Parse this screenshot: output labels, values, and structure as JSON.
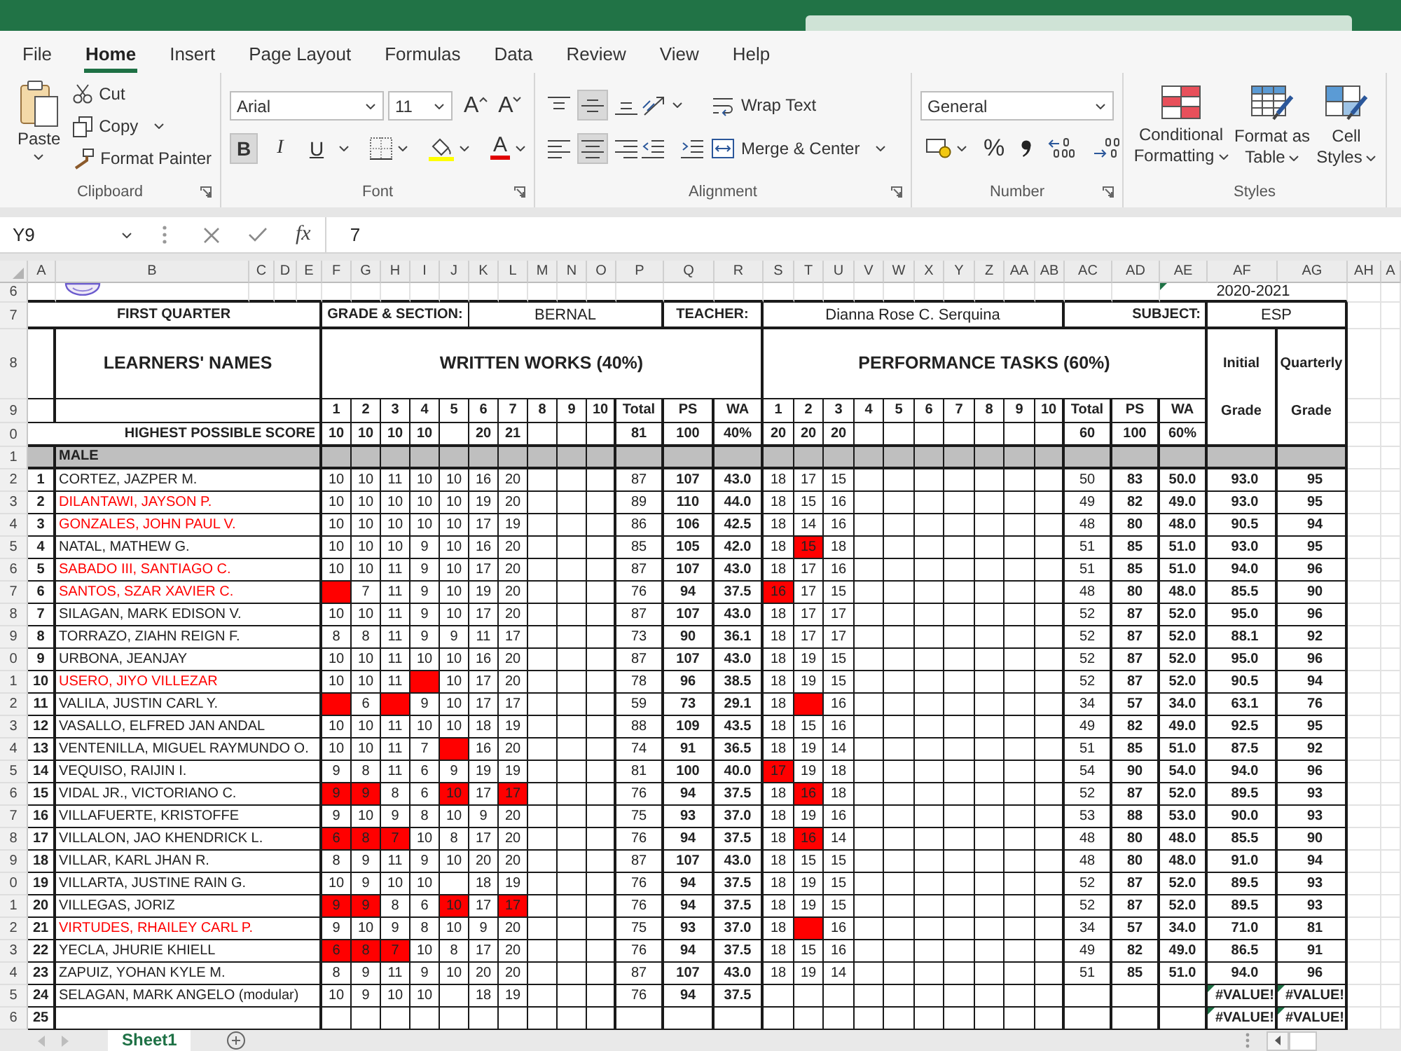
{
  "menu_tabs": [
    {
      "label": "File",
      "selected": false
    },
    {
      "label": "Home",
      "selected": true
    },
    {
      "label": "Insert",
      "selected": false
    },
    {
      "label": "Page Layout",
      "selected": false
    },
    {
      "label": "Formulas",
      "selected": false
    },
    {
      "label": "Data",
      "selected": false
    },
    {
      "label": "Review",
      "selected": false
    },
    {
      "label": "View",
      "selected": false
    },
    {
      "label": "Help",
      "selected": false
    }
  ],
  "ribbon": {
    "clipboard": {
      "paste": "Paste",
      "cut": "Cut",
      "copy": "Copy",
      "format_painter": "Format Painter",
      "label": "Clipboard"
    },
    "font": {
      "name": "Arial",
      "size": "11",
      "grow": "A",
      "shrink": "A",
      "styles": [
        {
          "label": "B",
          "kind": "bold",
          "selected": true
        },
        {
          "label": "I",
          "kind": "italic",
          "selected": false
        },
        {
          "label": "U",
          "kind": "underline",
          "selected": false
        }
      ],
      "font_color": "A",
      "label": "Font"
    },
    "alignment": {
      "vertical": [
        {
          "kind": "top",
          "selected": false
        },
        {
          "kind": "middle",
          "selected": true
        },
        {
          "kind": "bottom",
          "selected": false
        }
      ],
      "horizontal": [
        {
          "kind": "left",
          "selected": false
        },
        {
          "kind": "center",
          "selected": true
        },
        {
          "kind": "right",
          "selected": false
        }
      ],
      "wrap_text": "Wrap Text",
      "merge": "Merge & Center",
      "label": "Alignment"
    },
    "number": {
      "format": "General",
      "percent": "%",
      "label": "Number"
    },
    "styles": {
      "buttons": [
        {
          "label": "Conditional Formatting",
          "kind": "conditional"
        },
        {
          "label": "Format as Table",
          "kind": "table"
        },
        {
          "label": "Cell Styles",
          "kind": "cell"
        }
      ],
      "label": "Styles"
    }
  },
  "formula_bar": {
    "name_box": "Y9",
    "function_label": "fx",
    "formula": "7"
  },
  "sheet": {
    "column_headers": [
      "A",
      "B",
      "C",
      "D",
      "E",
      "F",
      "G",
      "H",
      "I",
      "J",
      "K",
      "L",
      "M",
      "N",
      "O",
      "P",
      "Q",
      "R",
      "S",
      "T",
      "U",
      "V",
      "W",
      "X",
      "Y",
      "Z",
      "AA",
      "AB",
      "AC",
      "AD",
      "AE",
      "AF",
      "AG",
      "AH",
      "A"
    ],
    "header_row_numbers": [
      "6",
      "7",
      "8",
      "9",
      "0",
      "1"
    ],
    "school_year": "2020-2021",
    "school_year_error_mark": true,
    "quarter": "FIRST QUARTER",
    "grade_section_label": "GRADE & SECTION:",
    "grade_section": "BERNAL",
    "teacher_label": "TEACHER:",
    "teacher": "Dianna Rose C. Serquina",
    "subject_label": "SUBJECT:",
    "subject": "ESP",
    "names_heading": "LEARNERS' NAMES",
    "written_heading": "WRITTEN WORKS (40%)",
    "performance_heading": "PERFORMANCE TASKS (60%)",
    "initial_heading": "Initial",
    "initial_subheading": "Grade",
    "quarterly_heading": "Quarterly",
    "quarterly_subheading": "Grade",
    "written_columns": [
      "1",
      "2",
      "3",
      "4",
      "5",
      "6",
      "7",
      "8",
      "9",
      "10",
      "Total",
      "PS",
      "WA"
    ],
    "performance_columns": [
      "1",
      "2",
      "3",
      "4",
      "5",
      "6",
      "7",
      "8",
      "9",
      "10",
      "Total",
      "PS",
      "WA"
    ],
    "highest_possible": {
      "label": "HIGHEST POSSIBLE SCORE",
      "written_scores": [
        {
          "kind": "score",
          "score": "10"
        },
        {
          "kind": "score",
          "score": "10"
        },
        {
          "kind": "score",
          "score": "10"
        },
        {
          "kind": "score",
          "score": "10"
        },
        {
          "kind": "blank"
        },
        {
          "kind": "score",
          "score": "20"
        },
        {
          "kind": "score",
          "score": "21"
        }
      ],
      "written_total": "81",
      "written_ps": "100",
      "written_wa": "40%",
      "performance_scores": [
        {
          "kind": "score",
          "score": "20"
        },
        {
          "kind": "score",
          "score": "20"
        },
        {
          "kind": "score",
          "score": "20"
        }
      ],
      "performance_total": "60",
      "performance_ps": "100",
      "performance_wa": "60%"
    },
    "group_label": "MALE",
    "learners": [
      {
        "number": "1",
        "row_number": "2",
        "name": "CORTEZ, JAZPER M.",
        "color": "#222222",
        "written_scores": [
          {
            "score": "10",
            "highlighted": false
          },
          {
            "score": "10",
            "highlighted": false
          },
          {
            "score": "11",
            "highlighted": false
          },
          {
            "score": "10",
            "highlighted": false
          },
          {
            "score": "10",
            "highlighted": false
          },
          {
            "score": "16",
            "highlighted": false
          },
          {
            "score": "20",
            "highlighted": false
          }
        ],
        "written_total": "87",
        "written_ps": "107",
        "written_wa": "43.0",
        "performance_scores": [
          {
            "score": "18",
            "highlighted": false
          },
          {
            "score": "17",
            "highlighted": false
          },
          {
            "score": "15",
            "highlighted": false
          }
        ],
        "performance_total": "50",
        "performance_ps": "83",
        "performance_wa": "50.0",
        "initial_grade": "93.0",
        "quarterly_grade": "95",
        "grade_error_marks": false
      },
      {
        "number": "2",
        "row_number": "3",
        "name": "DILANTAWI, JAYSON P.",
        "color": "#ff0000",
        "written_scores": [
          {
            "score": "10",
            "highlighted": false
          },
          {
            "score": "10",
            "highlighted": false
          },
          {
            "score": "10",
            "highlighted": false
          },
          {
            "score": "10",
            "highlighted": false
          },
          {
            "score": "10",
            "highlighted": false
          },
          {
            "score": "19",
            "highlighted": false
          },
          {
            "score": "20",
            "highlighted": false
          }
        ],
        "written_total": "89",
        "written_ps": "110",
        "written_wa": "44.0",
        "performance_scores": [
          {
            "score": "18",
            "highlighted": false
          },
          {
            "score": "15",
            "highlighted": false
          },
          {
            "score": "16",
            "highlighted": false
          }
        ],
        "performance_total": "49",
        "performance_ps": "82",
        "performance_wa": "49.0",
        "initial_grade": "93.0",
        "quarterly_grade": "95",
        "grade_error_marks": false
      },
      {
        "number": "3",
        "row_number": "4",
        "name": "GONZALES, JOHN PAUL V.",
        "color": "#ff0000",
        "written_scores": [
          {
            "score": "10",
            "highlighted": false
          },
          {
            "score": "10",
            "highlighted": false
          },
          {
            "score": "10",
            "highlighted": false
          },
          {
            "score": "10",
            "highlighted": false
          },
          {
            "score": "10",
            "highlighted": false
          },
          {
            "score": "17",
            "highlighted": false
          },
          {
            "score": "19",
            "highlighted": false
          }
        ],
        "written_total": "86",
        "written_ps": "106",
        "written_wa": "42.5",
        "performance_scores": [
          {
            "score": "18",
            "highlighted": false
          },
          {
            "score": "14",
            "highlighted": false
          },
          {
            "score": "16",
            "highlighted": false
          }
        ],
        "performance_total": "48",
        "performance_ps": "80",
        "performance_wa": "48.0",
        "initial_grade": "90.5",
        "quarterly_grade": "94",
        "grade_error_marks": false
      },
      {
        "number": "4",
        "row_number": "5",
        "name": "NATAL, MATHEW G.",
        "color": "#222222",
        "written_scores": [
          {
            "score": "10",
            "highlighted": false
          },
          {
            "score": "10",
            "highlighted": false
          },
          {
            "score": "10",
            "highlighted": false
          },
          {
            "score": "9",
            "highlighted": false
          },
          {
            "score": "10",
            "highlighted": false
          },
          {
            "score": "16",
            "highlighted": false
          },
          {
            "score": "20",
            "highlighted": false
          }
        ],
        "written_total": "85",
        "written_ps": "105",
        "written_wa": "42.0",
        "performance_scores": [
          {
            "score": "18",
            "highlighted": false
          },
          {
            "score": "15",
            "highlighted": true
          },
          {
            "score": "18",
            "highlighted": false
          }
        ],
        "performance_total": "51",
        "performance_ps": "85",
        "performance_wa": "51.0",
        "initial_grade": "93.0",
        "quarterly_grade": "95",
        "grade_error_marks": false
      },
      {
        "number": "5",
        "row_number": "6",
        "name": "SABADO III, SANTIAGO C.",
        "color": "#ff0000",
        "written_scores": [
          {
            "score": "10",
            "highlighted": false
          },
          {
            "score": "10",
            "highlighted": false
          },
          {
            "score": "11",
            "highlighted": false
          },
          {
            "score": "9",
            "highlighted": false
          },
          {
            "score": "10",
            "highlighted": false
          },
          {
            "score": "17",
            "highlighted": false
          },
          {
            "score": "20",
            "highlighted": false
          }
        ],
        "written_total": "87",
        "written_ps": "107",
        "written_wa": "43.0",
        "performance_scores": [
          {
            "score": "18",
            "highlighted": false
          },
          {
            "score": "17",
            "highlighted": false
          },
          {
            "score": "16",
            "highlighted": false
          }
        ],
        "performance_total": "51",
        "performance_ps": "85",
        "performance_wa": "51.0",
        "initial_grade": "94.0",
        "quarterly_grade": "96",
        "grade_error_marks": false
      },
      {
        "number": "6",
        "row_number": "7",
        "name": "SANTOS, SZAR XAVIER C.",
        "color": "#ff0000",
        "written_scores": [
          {
            "highlighted": true
          },
          {
            "score": "7",
            "highlighted": false
          },
          {
            "score": "11",
            "highlighted": false
          },
          {
            "score": "9",
            "highlighted": false
          },
          {
            "score": "10",
            "highlighted": false
          },
          {
            "score": "19",
            "highlighted": false
          },
          {
            "score": "20",
            "highlighted": false
          }
        ],
        "written_total": "76",
        "written_ps": "94",
        "written_wa": "37.5",
        "performance_scores": [
          {
            "score": "16",
            "highlighted": true
          },
          {
            "score": "17",
            "highlighted": false
          },
          {
            "score": "15",
            "highlighted": false
          }
        ],
        "performance_total": "48",
        "performance_ps": "80",
        "performance_wa": "48.0",
        "initial_grade": "85.5",
        "quarterly_grade": "90",
        "grade_error_marks": false
      },
      {
        "number": "7",
        "row_number": "8",
        "name": "SILAGAN, MARK EDISON V.",
        "color": "#222222",
        "written_scores": [
          {
            "score": "10",
            "highlighted": false
          },
          {
            "score": "10",
            "highlighted": false
          },
          {
            "score": "11",
            "highlighted": false
          },
          {
            "score": "9",
            "highlighted": false
          },
          {
            "score": "10",
            "highlighted": false
          },
          {
            "score": "17",
            "highlighted": false
          },
          {
            "score": "20",
            "highlighted": false
          }
        ],
        "written_total": "87",
        "written_ps": "107",
        "written_wa": "43.0",
        "performance_scores": [
          {
            "score": "18",
            "highlighted": false
          },
          {
            "score": "17",
            "highlighted": false
          },
          {
            "score": "17",
            "highlighted": false
          }
        ],
        "performance_total": "52",
        "performance_ps": "87",
        "performance_wa": "52.0",
        "initial_grade": "95.0",
        "quarterly_grade": "96",
        "grade_error_marks": false
      },
      {
        "number": "8",
        "row_number": "9",
        "name": "TORRAZO, ZIAHN REIGN F.",
        "color": "#222222",
        "written_scores": [
          {
            "score": "8",
            "highlighted": false
          },
          {
            "score": "8",
            "highlighted": false
          },
          {
            "score": "11",
            "highlighted": false
          },
          {
            "score": "9",
            "highlighted": false
          },
          {
            "score": "9",
            "highlighted": false
          },
          {
            "score": "11",
            "highlighted": false
          },
          {
            "score": "17",
            "highlighted": false
          }
        ],
        "written_total": "73",
        "written_ps": "90",
        "written_wa": "36.1",
        "performance_scores": [
          {
            "score": "18",
            "highlighted": false
          },
          {
            "score": "17",
            "highlighted": false
          },
          {
            "score": "17",
            "highlighted": false
          }
        ],
        "performance_total": "52",
        "performance_ps": "87",
        "performance_wa": "52.0",
        "initial_grade": "88.1",
        "quarterly_grade": "92",
        "grade_error_marks": false
      },
      {
        "number": "9",
        "row_number": "0",
        "name": "URBONA, JEANJAY",
        "color": "#222222",
        "written_scores": [
          {
            "score": "10",
            "highlighted": false
          },
          {
            "score": "10",
            "highlighted": false
          },
          {
            "score": "11",
            "highlighted": false
          },
          {
            "score": "10",
            "highlighted": false
          },
          {
            "score": "10",
            "highlighted": false
          },
          {
            "score": "16",
            "highlighted": false
          },
          {
            "score": "20",
            "highlighted": false
          }
        ],
        "written_total": "87",
        "written_ps": "107",
        "written_wa": "43.0",
        "performance_scores": [
          {
            "score": "18",
            "highlighted": false
          },
          {
            "score": "19",
            "highlighted": false
          },
          {
            "score": "15",
            "highlighted": false
          }
        ],
        "performance_total": "52",
        "performance_ps": "87",
        "performance_wa": "52.0",
        "initial_grade": "95.0",
        "quarterly_grade": "96",
        "grade_error_marks": false
      },
      {
        "number": "10",
        "row_number": "1",
        "name": "USERO, JIYO VILLEZAR",
        "color": "#ff0000",
        "written_scores": [
          {
            "score": "10",
            "highlighted": false
          },
          {
            "score": "10",
            "highlighted": false
          },
          {
            "score": "11",
            "highlighted": false
          },
          {
            "highlighted": true
          },
          {
            "score": "10",
            "highlighted": false
          },
          {
            "score": "17",
            "highlighted": false
          },
          {
            "score": "20",
            "highlighted": false
          }
        ],
        "written_total": "78",
        "written_ps": "96",
        "written_wa": "38.5",
        "performance_scores": [
          {
            "score": "18",
            "highlighted": false
          },
          {
            "score": "19",
            "highlighted": false
          },
          {
            "score": "15",
            "highlighted": false
          }
        ],
        "performance_total": "52",
        "performance_ps": "87",
        "performance_wa": "52.0",
        "initial_grade": "90.5",
        "quarterly_grade": "94",
        "grade_error_marks": false
      },
      {
        "number": "11",
        "row_number": "2",
        "name": "VALILA, JUSTIN CARL Y.",
        "color": "#222222",
        "written_scores": [
          {
            "highlighted": true
          },
          {
            "score": "6",
            "highlighted": false
          },
          {
            "highlighted": true
          },
          {
            "score": "9",
            "highlighted": false
          },
          {
            "score": "10",
            "highlighted": false
          },
          {
            "score": "17",
            "highlighted": false
          },
          {
            "score": "17",
            "highlighted": false
          }
        ],
        "written_total": "59",
        "written_ps": "73",
        "written_wa": "29.1",
        "performance_scores": [
          {
            "score": "18",
            "highlighted": false
          },
          {
            "highlighted": true
          },
          {
            "score": "16",
            "highlighted": false
          }
        ],
        "performance_total": "34",
        "performance_ps": "57",
        "performance_wa": "34.0",
        "initial_grade": "63.1",
        "quarterly_grade": "76",
        "grade_error_marks": false
      },
      {
        "number": "12",
        "row_number": "3",
        "name": "VASALLO, ELFRED JAN ANDAL",
        "color": "#222222",
        "written_scores": [
          {
            "score": "10",
            "highlighted": false
          },
          {
            "score": "10",
            "highlighted": false
          },
          {
            "score": "11",
            "highlighted": false
          },
          {
            "score": "10",
            "highlighted": false
          },
          {
            "score": "10",
            "highlighted": false
          },
          {
            "score": "18",
            "highlighted": false
          },
          {
            "score": "19",
            "highlighted": false
          }
        ],
        "written_total": "88",
        "written_ps": "109",
        "written_wa": "43.5",
        "performance_scores": [
          {
            "score": "18",
            "highlighted": false
          },
          {
            "score": "15",
            "highlighted": false
          },
          {
            "score": "16",
            "highlighted": false
          }
        ],
        "performance_total": "49",
        "performance_ps": "82",
        "performance_wa": "49.0",
        "initial_grade": "92.5",
        "quarterly_grade": "95",
        "grade_error_marks": false
      },
      {
        "number": "13",
        "row_number": "4",
        "name": "VENTENILLA, MIGUEL RAYMUNDO O.",
        "color": "#222222",
        "written_scores": [
          {
            "score": "10",
            "highlighted": false
          },
          {
            "score": "10",
            "highlighted": false
          },
          {
            "score": "11",
            "highlighted": false
          },
          {
            "score": "7",
            "highlighted": false
          },
          {
            "highlighted": true
          },
          {
            "score": "16",
            "highlighted": false
          },
          {
            "score": "20",
            "highlighted": false
          }
        ],
        "written_total": "74",
        "written_ps": "91",
        "written_wa": "36.5",
        "performance_scores": [
          {
            "score": "18",
            "highlighted": false
          },
          {
            "score": "19",
            "highlighted": false
          },
          {
            "score": "14",
            "highlighted": false
          }
        ],
        "performance_total": "51",
        "performance_ps": "85",
        "performance_wa": "51.0",
        "initial_grade": "87.5",
        "quarterly_grade": "92",
        "grade_error_marks": false
      },
      {
        "number": "14",
        "row_number": "5",
        "name": "VEQUISO, RAIJIN I.",
        "color": "#222222",
        "written_scores": [
          {
            "score": "9",
            "highlighted": false
          },
          {
            "score": "8",
            "highlighted": false
          },
          {
            "score": "11",
            "highlighted": false
          },
          {
            "score": "6",
            "highlighted": false
          },
          {
            "score": "9",
            "highlighted": false
          },
          {
            "score": "19",
            "highlighted": false
          },
          {
            "score": "19",
            "highlighted": false
          }
        ],
        "written_total": "81",
        "written_ps": "100",
        "written_wa": "40.0",
        "performance_scores": [
          {
            "score": "17",
            "highlighted": true
          },
          {
            "score": "19",
            "highlighted": false
          },
          {
            "score": "18",
            "highlighted": false
          }
        ],
        "performance_total": "54",
        "performance_ps": "90",
        "performance_wa": "54.0",
        "initial_grade": "94.0",
        "quarterly_grade": "96",
        "grade_error_marks": false
      },
      {
        "number": "15",
        "row_number": "6",
        "name": "VIDAL JR., VICTORIANO C.",
        "color": "#222222",
        "written_scores": [
          {
            "score": "9",
            "highlighted": true
          },
          {
            "score": "9",
            "highlighted": true
          },
          {
            "score": "8",
            "highlighted": false
          },
          {
            "score": "6",
            "highlighted": false
          },
          {
            "score": "10",
            "highlighted": true
          },
          {
            "score": "17",
            "highlighted": false
          },
          {
            "score": "17",
            "highlighted": true
          }
        ],
        "written_total": "76",
        "written_ps": "94",
        "written_wa": "37.5",
        "performance_scores": [
          {
            "score": "18",
            "highlighted": false
          },
          {
            "score": "16",
            "highlighted": true
          },
          {
            "score": "18",
            "highlighted": false
          }
        ],
        "performance_total": "52",
        "performance_ps": "87",
        "performance_wa": "52.0",
        "initial_grade": "89.5",
        "quarterly_grade": "93",
        "grade_error_marks": false
      },
      {
        "number": "16",
        "row_number": "7",
        "name": "VILLAFUERTE, KRISTOFFE",
        "color": "#222222",
        "written_scores": [
          {
            "score": "9",
            "highlighted": false
          },
          {
            "score": "10",
            "highlighted": false
          },
          {
            "score": "9",
            "highlighted": false
          },
          {
            "score": "8",
            "highlighted": false
          },
          {
            "score": "10",
            "highlighted": false
          },
          {
            "score": "9",
            "highlighted": false
          },
          {
            "score": "20",
            "highlighted": false
          }
        ],
        "written_total": "75",
        "written_ps": "93",
        "written_wa": "37.0",
        "performance_scores": [
          {
            "score": "18",
            "highlighted": false
          },
          {
            "score": "19",
            "highlighted": false
          },
          {
            "score": "16",
            "highlighted": false
          }
        ],
        "performance_total": "53",
        "performance_ps": "88",
        "performance_wa": "53.0",
        "initial_grade": "90.0",
        "quarterly_grade": "93",
        "grade_error_marks": false
      },
      {
        "number": "17",
        "row_number": "8",
        "name": "VILLALON, JAO KHENDRICK L.",
        "color": "#222222",
        "written_scores": [
          {
            "score": "6",
            "highlighted": true
          },
          {
            "score": "8",
            "highlighted": true
          },
          {
            "score": "7",
            "highlighted": true
          },
          {
            "score": "10",
            "highlighted": false
          },
          {
            "score": "8",
            "highlighted": false
          },
          {
            "score": "17",
            "highlighted": false
          },
          {
            "score": "20",
            "highlighted": false
          }
        ],
        "written_total": "76",
        "written_ps": "94",
        "written_wa": "37.5",
        "performance_scores": [
          {
            "score": "18",
            "highlighted": false
          },
          {
            "score": "16",
            "highlighted": true
          },
          {
            "score": "14",
            "highlighted": false
          }
        ],
        "performance_total": "48",
        "performance_ps": "80",
        "performance_wa": "48.0",
        "initial_grade": "85.5",
        "quarterly_grade": "90",
        "grade_error_marks": false
      },
      {
        "number": "18",
        "row_number": "9",
        "name": "VILLAR, KARL JHAN R.",
        "color": "#222222",
        "written_scores": [
          {
            "score": "8",
            "highlighted": false
          },
          {
            "score": "9",
            "highlighted": false
          },
          {
            "score": "11",
            "highlighted": false
          },
          {
            "score": "9",
            "highlighted": false
          },
          {
            "score": "10",
            "highlighted": false
          },
          {
            "score": "20",
            "highlighted": false
          },
          {
            "score": "20",
            "highlighted": false
          }
        ],
        "written_total": "87",
        "written_ps": "107",
        "written_wa": "43.0",
        "performance_scores": [
          {
            "score": "18",
            "highlighted": false
          },
          {
            "score": "15",
            "highlighted": false
          },
          {
            "score": "15",
            "highlighted": false
          }
        ],
        "performance_total": "48",
        "performance_ps": "80",
        "performance_wa": "48.0",
        "initial_grade": "91.0",
        "quarterly_grade": "94",
        "grade_error_marks": false
      },
      {
        "number": "19",
        "row_number": "0",
        "name": "VILLARTA, JUSTINE RAIN G.",
        "color": "#222222",
        "written_scores": [
          {
            "score": "10",
            "highlighted": false
          },
          {
            "score": "9",
            "highlighted": false
          },
          {
            "score": "10",
            "highlighted": false
          },
          {
            "score": "10",
            "highlighted": false
          },
          {
            "highlighted": false
          },
          {
            "score": "18",
            "highlighted": false
          },
          {
            "score": "19",
            "highlighted": false
          }
        ],
        "written_total": "76",
        "written_ps": "94",
        "written_wa": "37.5",
        "performance_scores": [
          {
            "score": "18",
            "highlighted": false
          },
          {
            "score": "19",
            "highlighted": false
          },
          {
            "score": "15",
            "highlighted": false
          }
        ],
        "performance_total": "52",
        "performance_ps": "87",
        "performance_wa": "52.0",
        "initial_grade": "89.5",
        "quarterly_grade": "93",
        "grade_error_marks": false
      },
      {
        "number": "20",
        "row_number": "1",
        "name": "VILLEGAS, JORIZ",
        "color": "#222222",
        "written_scores": [
          {
            "score": "9",
            "highlighted": true
          },
          {
            "score": "9",
            "highlighted": true
          },
          {
            "score": "8",
            "highlighted": false
          },
          {
            "score": "6",
            "highlighted": false
          },
          {
            "score": "10",
            "highlighted": true
          },
          {
            "score": "17",
            "highlighted": false
          },
          {
            "score": "17",
            "highlighted": true
          }
        ],
        "written_total": "76",
        "written_ps": "94",
        "written_wa": "37.5",
        "performance_scores": [
          {
            "score": "18",
            "highlighted": false
          },
          {
            "score": "19",
            "highlighted": false
          },
          {
            "score": "15",
            "highlighted": false
          }
        ],
        "performance_total": "52",
        "performance_ps": "87",
        "performance_wa": "52.0",
        "initial_grade": "89.5",
        "quarterly_grade": "93",
        "grade_error_marks": false
      },
      {
        "number": "21",
        "row_number": "2",
        "name": "VIRTUDES, RHAILEY CARL P.",
        "color": "#ff0000",
        "written_scores": [
          {
            "score": "9",
            "highlighted": false
          },
          {
            "score": "10",
            "highlighted": false
          },
          {
            "score": "9",
            "highlighted": false
          },
          {
            "score": "8",
            "highlighted": false
          },
          {
            "score": "10",
            "highlighted": false
          },
          {
            "score": "9",
            "highlighted": false
          },
          {
            "score": "20",
            "highlighted": false
          }
        ],
        "written_total": "75",
        "written_ps": "93",
        "written_wa": "37.0",
        "performance_scores": [
          {
            "score": "18",
            "highlighted": false
          },
          {
            "highlighted": true
          },
          {
            "score": "16",
            "highlighted": false
          }
        ],
        "performance_total": "34",
        "performance_ps": "57",
        "performance_wa": "34.0",
        "initial_grade": "71.0",
        "quarterly_grade": "81",
        "grade_error_marks": false
      },
      {
        "number": "22",
        "row_number": "3",
        "name": "YECLA, JHURIE KHIELL",
        "color": "#222222",
        "written_scores": [
          {
            "score": "6",
            "highlighted": true
          },
          {
            "score": "8",
            "highlighted": true
          },
          {
            "score": "7",
            "highlighted": true
          },
          {
            "score": "10",
            "highlighted": false
          },
          {
            "score": "8",
            "highlighted": false
          },
          {
            "score": "17",
            "highlighted": false
          },
          {
            "score": "20",
            "highlighted": false
          }
        ],
        "written_total": "76",
        "written_ps": "94",
        "written_wa": "37.5",
        "performance_scores": [
          {
            "score": "18",
            "highlighted": false
          },
          {
            "score": "15",
            "highlighted": false
          },
          {
            "score": "16",
            "highlighted": false
          }
        ],
        "performance_total": "49",
        "performance_ps": "82",
        "performance_wa": "49.0",
        "initial_grade": "86.5",
        "quarterly_grade": "91",
        "grade_error_marks": false
      },
      {
        "number": "23",
        "row_number": "4",
        "name": "ZAPUIZ, YOHAN KYLE M.",
        "color": "#222222",
        "written_scores": [
          {
            "score": "8",
            "highlighted": false
          },
          {
            "score": "9",
            "highlighted": false
          },
          {
            "score": "11",
            "highlighted": false
          },
          {
            "score": "9",
            "highlighted": false
          },
          {
            "score": "10",
            "highlighted": false
          },
          {
            "score": "20",
            "highlighted": false
          },
          {
            "score": "20",
            "highlighted": false
          }
        ],
        "written_total": "87",
        "written_ps": "107",
        "written_wa": "43.0",
        "performance_scores": [
          {
            "score": "18",
            "highlighted": false
          },
          {
            "score": "19",
            "highlighted": false
          },
          {
            "score": "14",
            "highlighted": false
          }
        ],
        "performance_total": "51",
        "performance_ps": "85",
        "performance_wa": "51.0",
        "initial_grade": "94.0",
        "quarterly_grade": "96",
        "grade_error_marks": false
      },
      {
        "number": "24",
        "row_number": "5",
        "name": "SELAGAN, MARK ANGELO (modular)",
        "color": "#222222",
        "written_scores": [
          {
            "score": "10",
            "highlighted": false
          },
          {
            "score": "9",
            "highlighted": false
          },
          {
            "score": "10",
            "highlighted": false
          },
          {
            "score": "10",
            "highlighted": false
          },
          {
            "highlighted": false
          },
          {
            "score": "18",
            "highlighted": false
          },
          {
            "score": "19",
            "highlighted": false
          }
        ],
        "written_total": "76",
        "written_ps": "94",
        "written_wa": "37.5",
        "initial_grade": "#VALUE!",
        "quarterly_grade": "#VALUE!",
        "grade_error_marks": true
      },
      {
        "number": "25",
        "row_number": "6",
        "initial_grade": "#VALUE!",
        "quarterly_grade": "#VALUE!",
        "grade_error_marks": true
      }
    ]
  },
  "sheet_tabs": [
    {
      "name": "Sheet1",
      "selected": true
    }
  ]
}
